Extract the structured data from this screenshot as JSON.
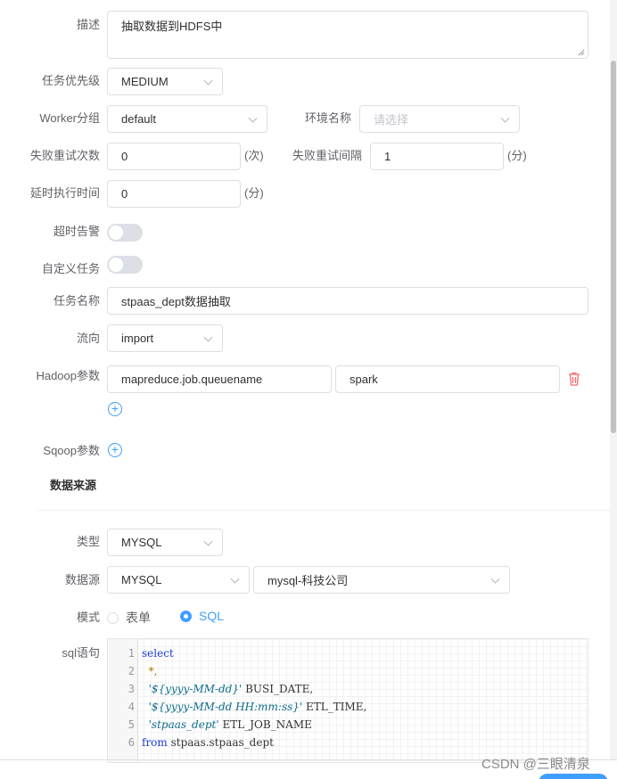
{
  "form": {
    "description": {
      "label": "描述",
      "value": "抽取数据到HDFS中"
    },
    "priority": {
      "label": "任务优先级",
      "value": "MEDIUM"
    },
    "worker_group": {
      "label": "Worker分组",
      "value": "default"
    },
    "environment": {
      "label": "环境名称",
      "placeholder": "请选择"
    },
    "retry_times": {
      "label": "失败重试次数",
      "value": "0",
      "unit": "(次)"
    },
    "retry_interval": {
      "label": "失败重试间隔",
      "value": "1",
      "unit": "(分)"
    },
    "delay_time": {
      "label": "延时执行时间",
      "value": "0",
      "unit": "(分)"
    },
    "timeout_alarm": {
      "label": "超时告警",
      "enabled": false
    },
    "custom_task": {
      "label": "自定义任务",
      "enabled": false
    },
    "task_name": {
      "label": "任务名称",
      "value": "stpaas_dept数据抽取"
    },
    "flow_direction": {
      "label": "流向",
      "value": "import"
    },
    "hadoop_params": {
      "label": "Hadoop参数",
      "key": "mapreduce.job.queuename",
      "value": "spark"
    },
    "sqoop_params": {
      "label": "Sqoop参数"
    }
  },
  "data_source_section": {
    "title": "数据来源",
    "type": {
      "label": "类型",
      "value": "MYSQL"
    },
    "datasource": {
      "label": "数据源",
      "type_value": "MYSQL",
      "name_value": "mysql-科技公司"
    },
    "mode": {
      "label": "模式",
      "options": [
        "表单",
        "SQL"
      ],
      "selected": "SQL"
    },
    "sql": {
      "label": "sql语句",
      "line_numbers": [
        "1",
        "2",
        "3",
        "4",
        "5",
        "6"
      ],
      "lines": [
        {
          "kw": "select"
        },
        {
          "star": "  *,"
        },
        {
          "str": "  '${yyyy-MM-dd}'",
          "rest": " BUSI_DATE,"
        },
        {
          "str": "  '${yyyy-MM-dd HH:mm:ss}'",
          "rest": " ETL_TIME,"
        },
        {
          "str": "  'stpaas_dept'",
          "rest": " ETL_JOB_NAME"
        },
        {
          "kw": "from",
          "rest": " stpaas.stpaas_dept"
        }
      ]
    }
  },
  "watermark": "CSDN @三眼清泉",
  "colors": {
    "primary": "#409eff",
    "danger": "#f56c6c",
    "border": "#dcdfe6"
  }
}
